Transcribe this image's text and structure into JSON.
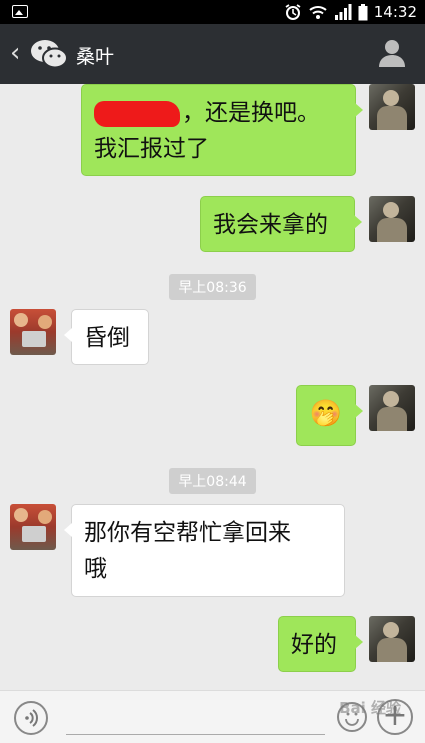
{
  "status_bar": {
    "time": "14:32",
    "signal_label": "📶"
  },
  "header": {
    "back_glyph": "‹",
    "contact_name": "桑叶"
  },
  "messages": [
    {
      "from": "me",
      "text_suffix": "，还是换吧。",
      "text_line2": "我汇报过了"
    },
    {
      "from": "me",
      "text": "我会来拿的"
    },
    {
      "type": "time",
      "text": "早上08:36"
    },
    {
      "from": "other",
      "text": "昏倒"
    },
    {
      "from": "me",
      "emoji": "🤭"
    },
    {
      "type": "time",
      "text": "早上08:44"
    },
    {
      "from": "other",
      "text": "那你有空帮忙拿回来",
      "text_line2": "哦"
    },
    {
      "from": "me",
      "text": "好的"
    }
  ],
  "watermark": "Bai 经验",
  "input": {
    "plus_glyph": "+"
  },
  "colors": {
    "bubble_me": "#9fe65a",
    "bubble_other": "#ffffff",
    "header": "#2c2f33"
  }
}
